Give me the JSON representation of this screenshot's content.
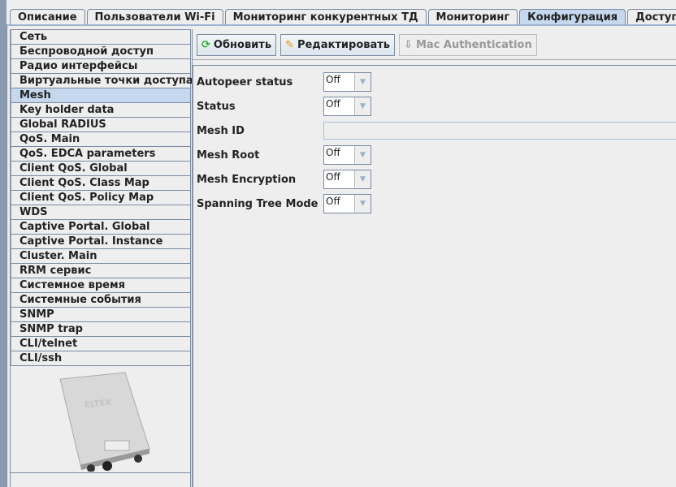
{
  "tabs": [
    "Описание",
    "Пользователи Wi-Fi",
    "Мониторинг конкурентных ТД",
    "Мониторинг",
    "Конфигурация",
    "Доступ"
  ],
  "selected_tab": "Конфигурация",
  "sidebar": {
    "items": [
      "Сеть",
      "Беспроводной доступ",
      "Радио интерфейсы",
      "Виртуальные точки доступа",
      "Mesh",
      "Key holder data",
      "Global RADIUS",
      "QoS. Main",
      "QoS. EDCA parameters",
      "Client QoS. Global",
      "Client QoS. Class Map",
      "Client QoS. Policy Map",
      "WDS",
      "Captive Portal. Global",
      "Captive Portal. Instance",
      "Cluster. Main",
      "RRM сервис",
      "Системное время",
      "Системные события",
      "SNMP",
      "SNMP trap",
      "CLI/telnet",
      "CLI/ssh"
    ],
    "selected": "Mesh",
    "device_logo": "ELTEX"
  },
  "toolbar": {
    "refresh": "Обновить",
    "edit": "Редактировать",
    "mac_auth": "Mac Authentication"
  },
  "form": {
    "autopeer": {
      "label": "Autopeer status",
      "value": "Off"
    },
    "status": {
      "label": "Status",
      "value": "Off"
    },
    "mesh_id": {
      "label": "Mesh ID",
      "value": ""
    },
    "mesh_root": {
      "label": "Mesh Root",
      "value": "Off"
    },
    "mesh_enc": {
      "label": "Mesh Encryption",
      "value": "Off"
    },
    "stp": {
      "label": "Spanning Tree Mode",
      "value": "Off"
    }
  }
}
